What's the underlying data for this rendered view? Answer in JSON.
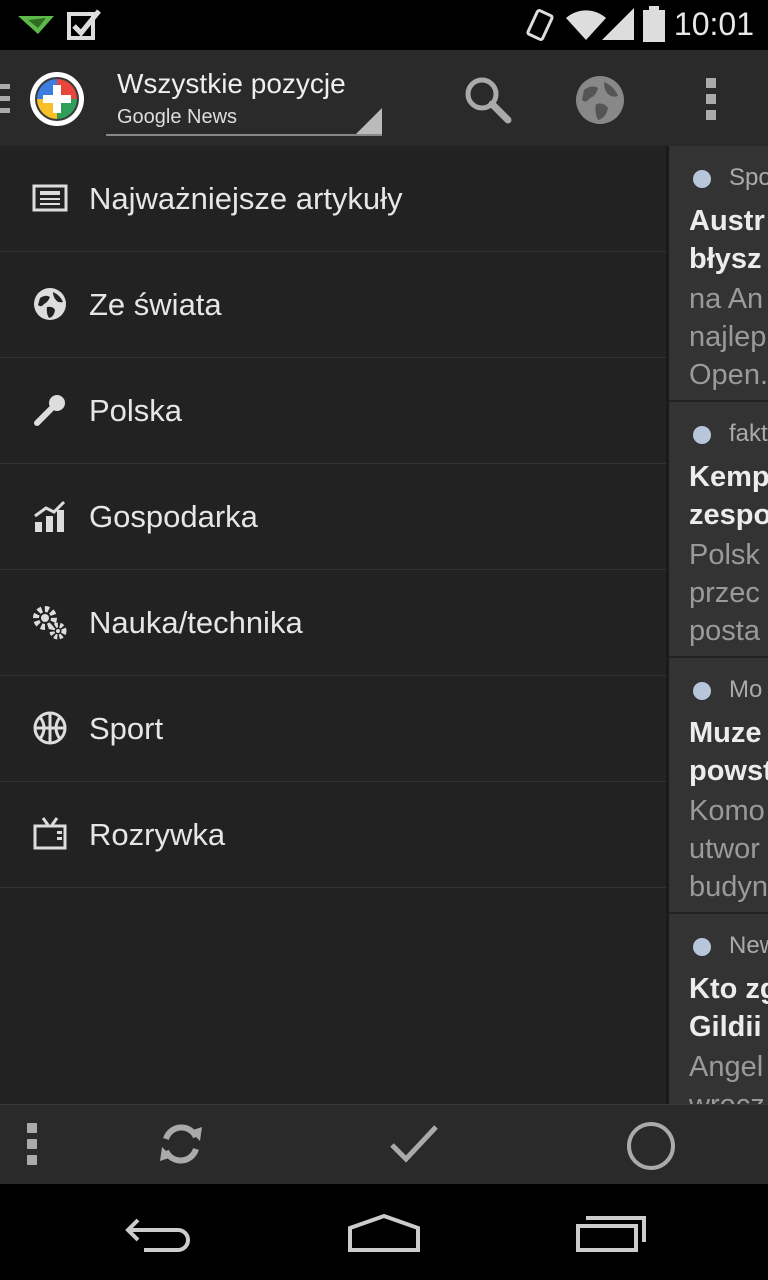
{
  "status": {
    "time": "10:01"
  },
  "header": {
    "title": "Wszystkie pozycje",
    "subtitle": "Google News"
  },
  "drawer": {
    "items": [
      {
        "label": "Najważniejsze artykuły",
        "icon": "newspaper-icon"
      },
      {
        "label": "Ze świata",
        "icon": "globe-icon"
      },
      {
        "label": "Polska",
        "icon": "microphone-icon"
      },
      {
        "label": "Gospodarka",
        "icon": "chart-icon"
      },
      {
        "label": "Nauka/technika",
        "icon": "gears-icon"
      },
      {
        "label": "Sport",
        "icon": "basketball-icon"
      },
      {
        "label": "Rozrywka",
        "icon": "tv-icon"
      }
    ]
  },
  "articles": [
    {
      "source": "Spo",
      "title": [
        "Austr",
        "błysz"
      ],
      "snippet": [
        "na An",
        "najlep",
        "Open."
      ]
    },
    {
      "source": "fakt",
      "title": [
        "Kemp",
        "zespo"
      ],
      "snippet": [
        "Polsk",
        "przec",
        "posta"
      ]
    },
    {
      "source": "Mo",
      "title": [
        "Muze",
        "powst"
      ],
      "snippet": [
        "Komo",
        "utwor",
        "budyn"
      ]
    },
    {
      "source": "New",
      "title": [
        "Kto zg",
        "Gildii"
      ],
      "snippet": [
        "Angel",
        "wrecz"
      ]
    }
  ]
}
